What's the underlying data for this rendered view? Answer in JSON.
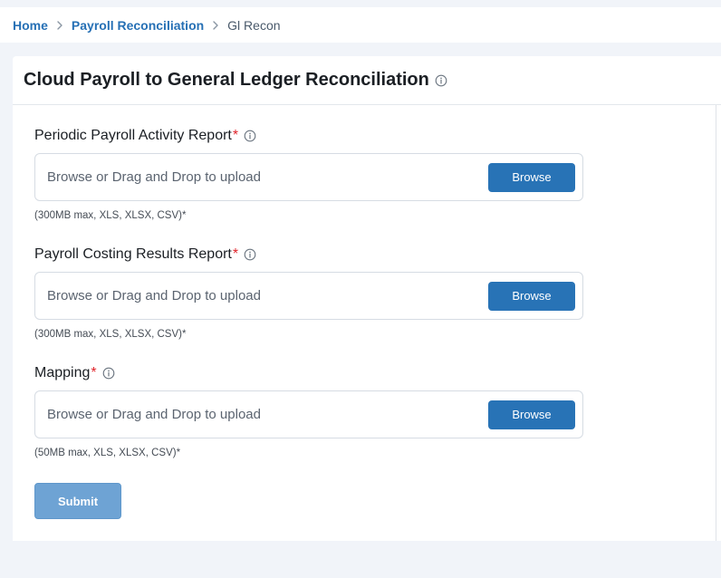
{
  "breadcrumb": {
    "items": [
      {
        "label": "Home"
      },
      {
        "label": "Payroll Reconciliation"
      },
      {
        "label": "Gl Recon"
      }
    ]
  },
  "page": {
    "title": "Cloud Payroll to General Ledger Reconciliation",
    "title_icon": "info-icon"
  },
  "form": {
    "fields": [
      {
        "label": "Periodic Payroll Activity Report",
        "required_mark": "*",
        "dropzone_text": "Browse or Drag and Drop to upload",
        "browse_label": "Browse",
        "hint": "(300MB max, XLS, XLSX, CSV)*"
      },
      {
        "label": "Payroll Costing Results Report",
        "required_mark": "*",
        "dropzone_text": "Browse or Drag and Drop to upload",
        "browse_label": "Browse",
        "hint": "(300MB max, XLS, XLSX, CSV)*"
      },
      {
        "label": "Mapping",
        "required_mark": "*",
        "dropzone_text": "Browse or Drag and Drop to upload",
        "browse_label": "Browse",
        "hint": "(50MB max, XLS, XLSX, CSV)*"
      }
    ],
    "submit_label": "Submit"
  },
  "colors": {
    "accent": "#2873b6",
    "link": "#2670b5",
    "required": "#e0242b",
    "submit_disabled": "#6ea3d4",
    "page_bg": "#f1f4f9"
  }
}
